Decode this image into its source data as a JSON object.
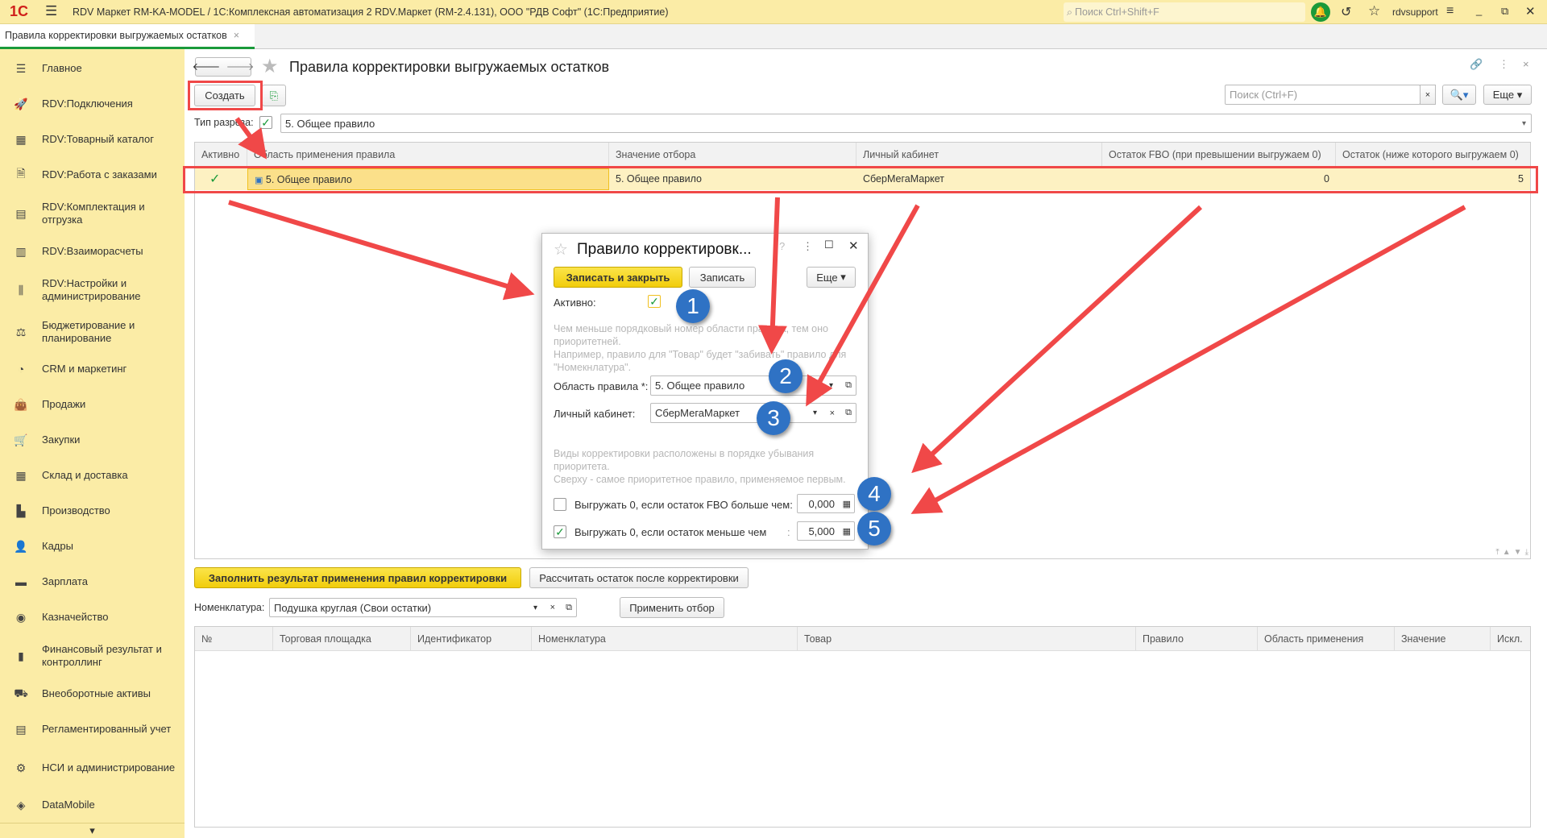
{
  "app": {
    "title": "RDV Маркет RM-KA-MODEL / 1С:Комплексная автоматизация 2 RDV.Маркет (RM-2.4.131), ООО \"РДВ Софт\"  (1С:Предприятие)",
    "logo": "1С",
    "global_search_placeholder": "Поиск Ctrl+Shift+F",
    "user": "rdvsupport"
  },
  "tab": {
    "label": "Правила корректировки выгружаемых остатков",
    "close": "×"
  },
  "sidebar": {
    "items": [
      {
        "label": "Главное",
        "icon": "menu-icon"
      },
      {
        "label": "RDV:Подключения",
        "icon": "rocket-icon"
      },
      {
        "label": "RDV:Товарный каталог",
        "icon": "grid-icon"
      },
      {
        "label": "RDV:Работа с заказами",
        "icon": "document-icon"
      },
      {
        "label": "RDV:Комплектация и отгрузка",
        "icon": "boxes-icon"
      },
      {
        "label": "RDV:Взаиморасчеты",
        "icon": "calculator-icon"
      },
      {
        "label": "RDV:Настройки и администрирование",
        "icon": "sliders-icon"
      },
      {
        "label": "Бюджетирование и планирование",
        "icon": "budget-icon"
      },
      {
        "label": "CRM и маркетинг",
        "icon": "pie-icon"
      },
      {
        "label": "Продажи",
        "icon": "bag-icon"
      },
      {
        "label": "Закупки",
        "icon": "cart-icon"
      },
      {
        "label": "Склад и доставка",
        "icon": "warehouse-icon"
      },
      {
        "label": "Производство",
        "icon": "factory-icon"
      },
      {
        "label": "Кадры",
        "icon": "person-icon"
      },
      {
        "label": "Зарплата",
        "icon": "wallet-icon"
      },
      {
        "label": "Казначейство",
        "icon": "coin-icon"
      },
      {
        "label": "Финансовый результат и контроллинг",
        "icon": "chart-icon"
      },
      {
        "label": "Внеоборотные активы",
        "icon": "truck-icon"
      },
      {
        "label": "Регламентированный учет",
        "icon": "ledger-icon"
      },
      {
        "label": "НСИ и администрирование",
        "icon": "gear-icon"
      },
      {
        "label": "DataMobile",
        "icon": "datamobile-icon"
      }
    ]
  },
  "form": {
    "title": "Правила корректировки выгружаемых остатков",
    "create": "Создать",
    "search_placeholder": "Поиск (Ctrl+F)",
    "more": "Еще",
    "filter_label": "Тип разреза:",
    "filter_value": "5. Общее правило",
    "columns": [
      "Активно",
      "Область применения правила",
      "Значение отбора",
      "Личный кабинет",
      "Остаток FBO (при превышении выгружаем 0)",
      "Остаток (ниже которого выгружаем 0)"
    ],
    "rows": [
      {
        "active": "✓",
        "scope": "5. Общее правило",
        "value": "5. Общее правило",
        "cabinet": "СберМегаМаркет",
        "fbo": "0",
        "min": "5"
      }
    ],
    "fill_button": "Заполнить результат применения правил корректировки",
    "calc_button": "Рассчитать остаток после корректировки",
    "nom_label": "Номенклатура:",
    "nom_value": "Подушка круглая (Свои остатки)",
    "apply_button": "Применить отбор",
    "columns2": [
      "№",
      "Торговая площадка",
      "Идентификатор",
      "Номенклатура",
      "Товар",
      "Правило",
      "Область применения",
      "Значение",
      "Искл."
    ]
  },
  "dialog": {
    "title": "Правило корректировк...",
    "save_close": "Записать и закрыть",
    "save": "Записать",
    "more": "Еще",
    "active_label": "Активно:",
    "hint1": "Чем меньше порядковый номер области правила, тем оно приоритетней.",
    "hint2": "Например, правило для \"Товар\" будет \"забивать\" правило для \"Номекнлатура\".",
    "scope_label": "Область правила *:",
    "scope_value": "5. Общее правило",
    "cabinet_label": "Личный кабинет:",
    "cabinet_value": "СберМегаМаркет",
    "hint3": "Виды корректировки расположены в порядке убывания приоритета.",
    "hint4": "Сверху - самое приоритетное правило, применяемое первым.",
    "fbo_label": "Выгружать 0, если остаток FBO больше чем:",
    "fbo_value": "0,000",
    "fbo_checked": false,
    "min_label": "Выгружать 0, если остаток меньше чем",
    "min_colon": ":",
    "min_value": "5,000",
    "min_checked": true
  },
  "annotations": [
    "1",
    "2",
    "3",
    "4",
    "5"
  ],
  "colors": {
    "accent": "#fbeca6",
    "highlight": "#ff4040",
    "badge": "#2f72c4"
  }
}
